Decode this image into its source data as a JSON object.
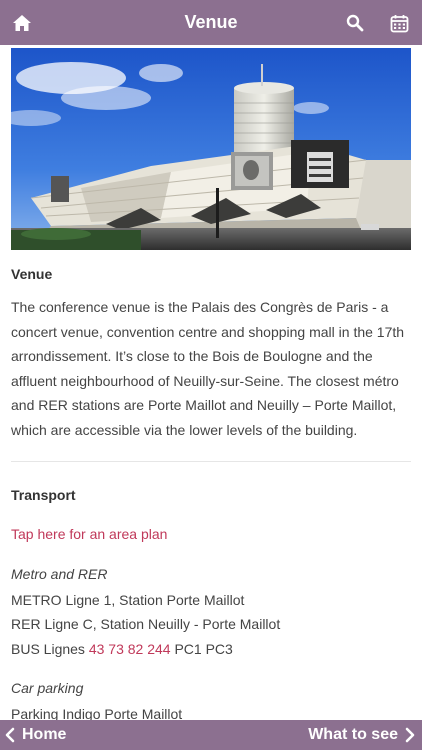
{
  "header": {
    "title": "Venue",
    "home_icon": "home-icon",
    "search_icon": "search-icon",
    "calendar_icon": "calendar-icon"
  },
  "venue": {
    "heading": "Venue",
    "description": "The conference venue is the Palais des Congrès de Paris - a concert venue, convention centre and shopping mall in the 17th arrondissement. It’s close to the Bois de Boulogne and the affluent neighbourhood of Neuilly-sur-Seine. The closest métro and RER stations are Porte Maillot and Neuilly – Porte Maillot, which are accessible via the lower levels of the building."
  },
  "transport": {
    "heading": "Transport",
    "area_plan_link": "Tap here for an area plan",
    "metro_heading": "Metro and RER",
    "metro_line": "METRO Ligne 1, Station Porte Maillot",
    "rer_line": "RER Ligne C, Station Neuilly - Porte Maillot",
    "bus_prefix": "BUS Lignes",
    "bus_numbers": "43 73 82 244",
    "bus_suffix": "PC1 PC3",
    "parking_heading": "Car parking",
    "parking_line": "Parking Indigo Porte Maillot"
  },
  "footer": {
    "back_label": "Home",
    "next_label": "What to see",
    "back_icon": "chevron-left-icon",
    "next_icon": "chevron-right-icon"
  },
  "colors": {
    "bar": "#8c7090",
    "link": "#c0395a"
  }
}
